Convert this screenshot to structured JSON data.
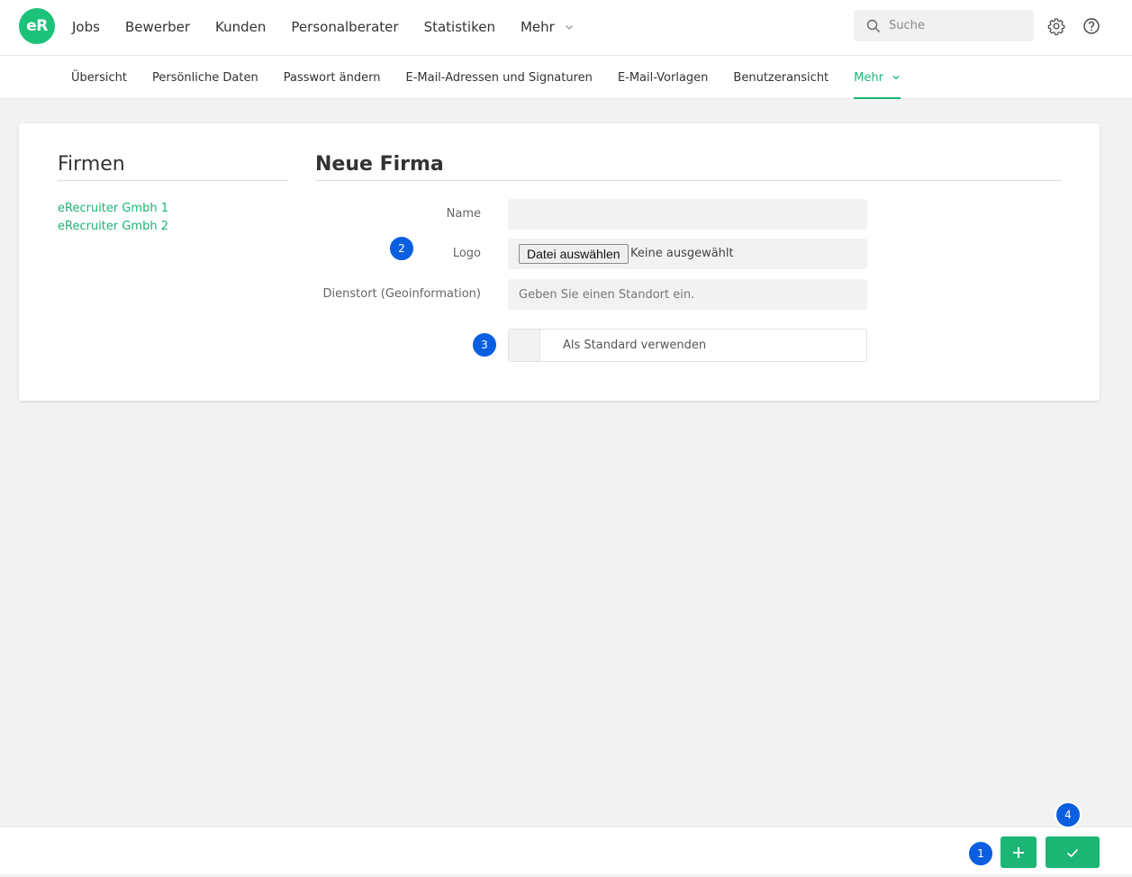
{
  "app": {
    "logo_text": "eR",
    "brand_color": "#1bc27a",
    "accent_color": "#1bb574",
    "badge_color": "#0a5fe0"
  },
  "main_nav": {
    "items": [
      {
        "label": "Jobs"
      },
      {
        "label": "Bewerber"
      },
      {
        "label": "Kunden"
      },
      {
        "label": "Personalberater"
      },
      {
        "label": "Statistiken"
      },
      {
        "label": "Mehr",
        "icon": "chevron-down-icon"
      }
    ]
  },
  "search": {
    "placeholder": "Suche",
    "icon": "search-icon"
  },
  "top_icons": {
    "settings": "gear-icon",
    "help": "help-icon"
  },
  "sub_nav": {
    "tabs": [
      {
        "label": "Übersicht"
      },
      {
        "label": "Persönliche Daten"
      },
      {
        "label": "Passwort ändern"
      },
      {
        "label": "E-Mail-Adressen und Signaturen"
      },
      {
        "label": "E-Mail-Vorlagen"
      },
      {
        "label": "Benutzeransicht"
      },
      {
        "label": "Mehr",
        "active": true,
        "icon": "chevron-down-icon"
      }
    ]
  },
  "firmen": {
    "title": "Firmen",
    "items": [
      {
        "label": "eRecruiter Gmbh 1"
      },
      {
        "label": "eRecruiter Gmbh 2"
      }
    ]
  },
  "form": {
    "title": "Neue Firma",
    "name": {
      "label": "Name",
      "value": ""
    },
    "logo": {
      "label": "Logo",
      "button": "Datei auswählen",
      "status": "Keine ausgewählt"
    },
    "location": {
      "label": "Dienstort (Geoinformation)",
      "placeholder": "Geben Sie einen Standort ein."
    },
    "default_toggle": {
      "label": "Als Standard verwenden",
      "checked": false
    }
  },
  "badges": {
    "b1": "1",
    "b2": "2",
    "b3": "3",
    "b4": "4"
  },
  "footer": {
    "add_icon": "plus-icon",
    "save_icon": "check-icon"
  }
}
